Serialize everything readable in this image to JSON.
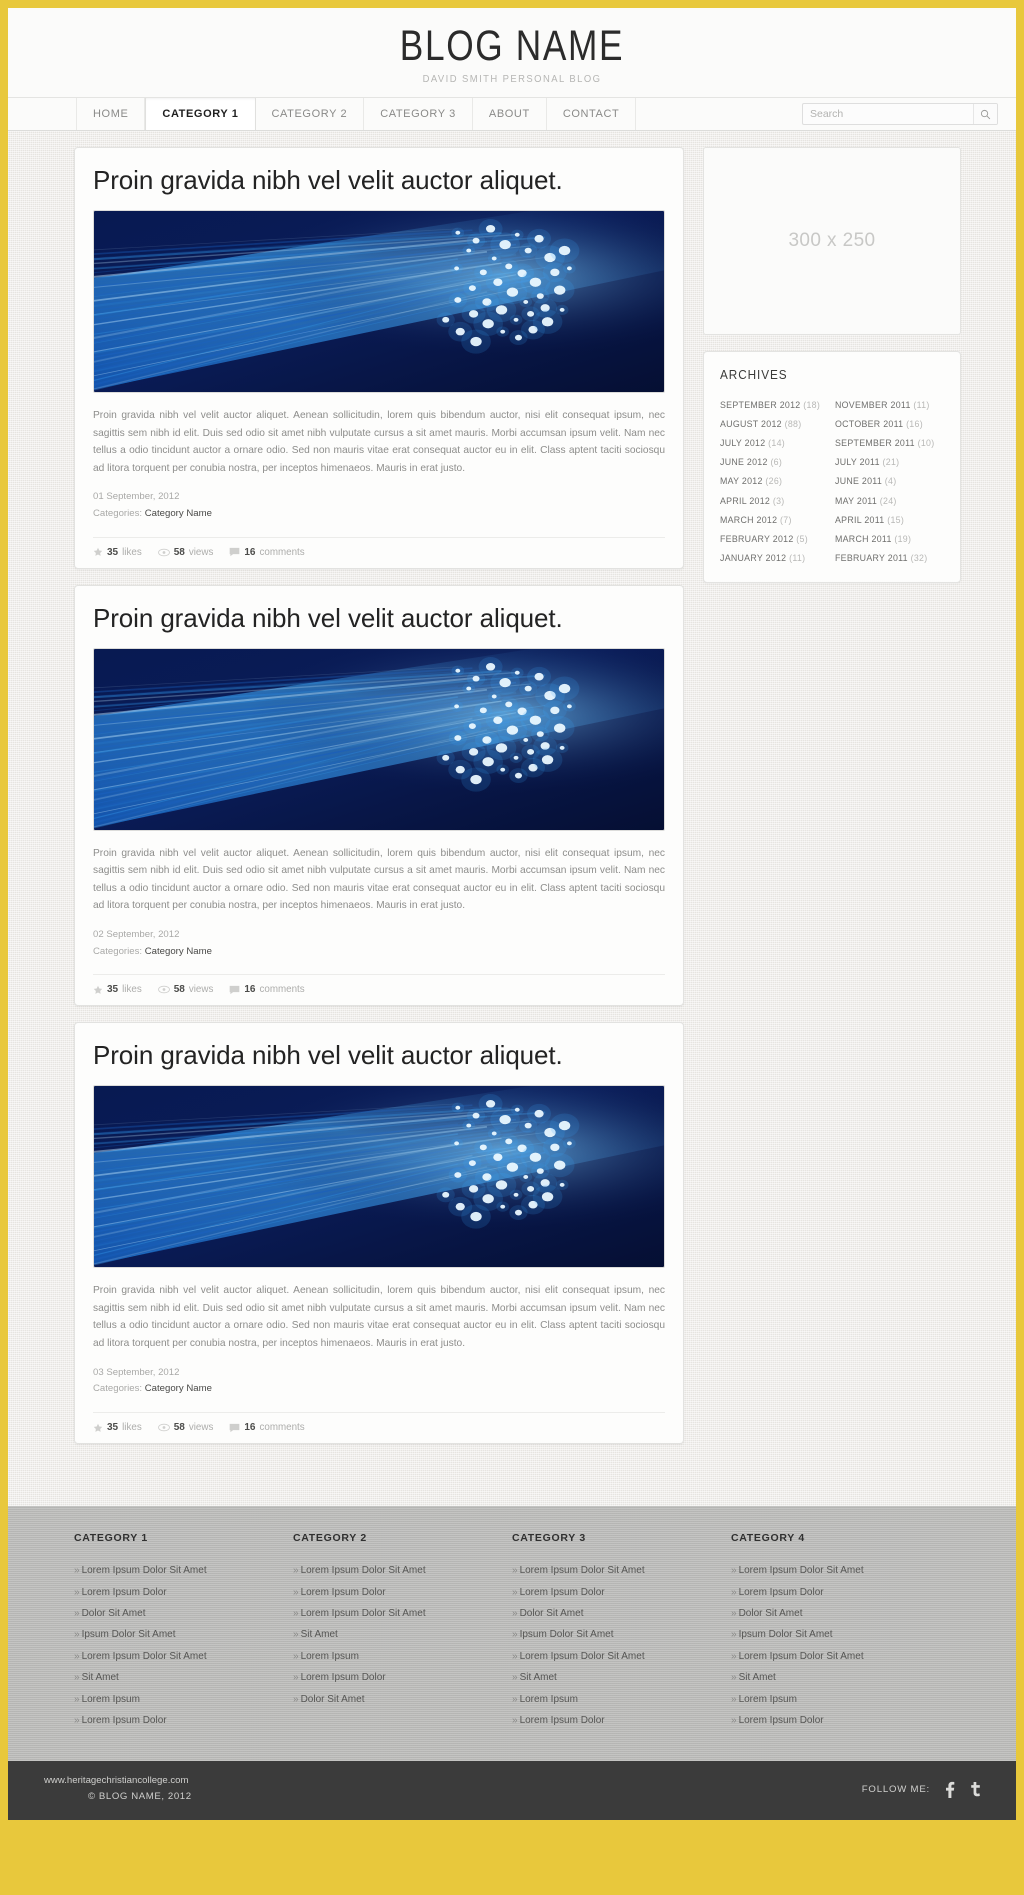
{
  "theme": {
    "accent": "#e8c83c",
    "footer_bg": "#b9b9b7",
    "bottombar_bg": "#3b3b3b"
  },
  "header": {
    "title": "BLOG NAME",
    "tagline": "DAVID SMITH PERSONAL BLOG"
  },
  "nav": {
    "items": [
      {
        "label": "HOME",
        "active": false
      },
      {
        "label": "CATEGORY 1",
        "active": true
      },
      {
        "label": "CATEGORY 2",
        "active": false
      },
      {
        "label": "CATEGORY 3",
        "active": false
      },
      {
        "label": "ABOUT",
        "active": false
      },
      {
        "label": "CONTACT",
        "active": false
      }
    ],
    "search": {
      "placeholder": "Search",
      "value": "",
      "icon": "search-icon"
    }
  },
  "posts": [
    {
      "title": "Proin gravida nibh vel velit auctor aliquet.",
      "image_alt": "fiber-optic-cables",
      "body": "Proin gravida nibh vel velit auctor aliquet. Aenean sollicitudin, lorem quis bibendum auctor, nisi elit consequat ipsum, nec sagittis sem nibh id elit. Duis sed odio sit amet nibh vulputate cursus a sit amet mauris. Morbi accumsan ipsum velit. Nam nec tellus a odio tincidunt auctor a ornare odio. Sed non  mauris vitae erat consequat auctor eu in elit. Class aptent taciti sociosqu ad litora torquent per conubia nostra, per inceptos himenaeos. Mauris in erat justo.",
      "date": "01 September, 2012",
      "categories_label": "Categories:",
      "category": "Category Name",
      "stats": {
        "likes": "35",
        "likes_label": "likes",
        "views": "58",
        "views_label": "views",
        "comments": "16",
        "comments_label": "comments"
      }
    },
    {
      "title": "Proin gravida nibh vel velit auctor aliquet.",
      "image_alt": "fiber-optic-cables",
      "body": "Proin gravida nibh vel velit auctor aliquet. Aenean sollicitudin, lorem quis bibendum auctor, nisi elit consequat ipsum, nec sagittis sem nibh id elit. Duis sed odio sit amet nibh vulputate cursus a sit amet mauris. Morbi accumsan ipsum velit. Nam nec tellus a odio tincidunt auctor a ornare odio. Sed non  mauris vitae erat consequat auctor eu in elit. Class aptent taciti sociosqu ad litora torquent per conubia nostra, per inceptos himenaeos. Mauris in erat justo.",
      "date": "02 September, 2012",
      "categories_label": "Categories:",
      "category": "Category Name",
      "stats": {
        "likes": "35",
        "likes_label": "likes",
        "views": "58",
        "views_label": "views",
        "comments": "16",
        "comments_label": "comments"
      }
    },
    {
      "title": "Proin gravida nibh vel velit auctor aliquet.",
      "image_alt": "fiber-optic-cables",
      "body": "Proin gravida nibh vel velit auctor aliquet. Aenean sollicitudin, lorem quis bibendum auctor, nisi elit consequat ipsum, nec sagittis sem nibh id elit. Duis sed odio sit amet nibh vulputate cursus a sit amet mauris. Morbi accumsan ipsum velit. Nam nec tellus a odio tincidunt auctor a ornare odio. Sed non  mauris vitae erat consequat auctor eu in elit. Class aptent taciti sociosqu ad litora torquent per conubia nostra, per inceptos himenaeos. Mauris in erat justo.",
      "date": "03 September, 2012",
      "categories_label": "Categories:",
      "category": "Category Name",
      "stats": {
        "likes": "35",
        "likes_label": "likes",
        "views": "58",
        "views_label": "views",
        "comments": "16",
        "comments_label": "comments"
      }
    }
  ],
  "sidebar": {
    "ad": {
      "label": "300 x 250"
    },
    "archives": {
      "title": "ARCHIVES",
      "left": [
        {
          "label": "SEPTEMBER 2012",
          "count": "(18)"
        },
        {
          "label": "AUGUST 2012",
          "count": "(88)"
        },
        {
          "label": "JULY 2012",
          "count": "(14)"
        },
        {
          "label": "JUNE 2012",
          "count": "(6)"
        },
        {
          "label": "MAY 2012",
          "count": "(26)"
        },
        {
          "label": "APRIL 2012",
          "count": "(3)"
        },
        {
          "label": "MARCH 2012",
          "count": "(7)"
        },
        {
          "label": "FEBRUARY 2012",
          "count": "(5)"
        },
        {
          "label": "JANUARY 2012",
          "count": "(11)"
        }
      ],
      "right": [
        {
          "label": "NOVEMBER 2011",
          "count": "(11)"
        },
        {
          "label": "OCTOBER 2011",
          "count": "(16)"
        },
        {
          "label": "SEPTEMBER 2011",
          "count": "(10)"
        },
        {
          "label": "JULY 2011",
          "count": "(21)"
        },
        {
          "label": "JUNE 2011",
          "count": "(4)"
        },
        {
          "label": "MAY 2011",
          "count": "(24)"
        },
        {
          "label": "APRIL 2011",
          "count": "(15)"
        },
        {
          "label": "MARCH 2011",
          "count": "(19)"
        },
        {
          "label": "FEBRUARY 2011",
          "count": "(32)"
        }
      ]
    }
  },
  "footer": {
    "columns": [
      {
        "title": "CATEGORY 1",
        "links": [
          "Lorem Ipsum Dolor Sit Amet",
          "Lorem Ipsum Dolor",
          "Dolor Sit Amet",
          "Ipsum Dolor Sit Amet",
          "Lorem Ipsum Dolor Sit Amet",
          "Sit Amet",
          "Lorem Ipsum",
          "Lorem Ipsum Dolor"
        ]
      },
      {
        "title": "CATEGORY 2",
        "links": [
          "Lorem Ipsum Dolor Sit Amet",
          "Lorem Ipsum Dolor",
          "Lorem Ipsum Dolor Sit Amet",
          "Sit Amet",
          "Lorem Ipsum",
          "Lorem Ipsum Dolor",
          "Dolor Sit Amet"
        ]
      },
      {
        "title": "CATEGORY 3",
        "links": [
          "Lorem Ipsum Dolor Sit Amet",
          "Lorem Ipsum Dolor",
          "Dolor Sit Amet",
          "Ipsum Dolor Sit Amet",
          "Lorem Ipsum Dolor Sit Amet",
          "Sit Amet",
          "Lorem Ipsum",
          "Lorem Ipsum Dolor"
        ]
      },
      {
        "title": "CATEGORY 4",
        "links": [
          "Lorem Ipsum Dolor Sit Amet",
          "Lorem Ipsum Dolor",
          "Dolor Sit Amet",
          "Ipsum Dolor Sit Amet",
          "Lorem Ipsum Dolor Sit Amet",
          "Sit Amet",
          "Lorem Ipsum",
          "Lorem Ipsum Dolor"
        ]
      }
    ],
    "chevron": "»"
  },
  "bottombar": {
    "website": "www.heritagechristiancollege.com",
    "copyright": "© BLOG NAME, 2012",
    "follow_label": "FOLLOW ME:",
    "socials": [
      {
        "name": "facebook-icon",
        "glyph": "f"
      },
      {
        "name": "twitter-icon",
        "glyph": "t"
      }
    ]
  }
}
